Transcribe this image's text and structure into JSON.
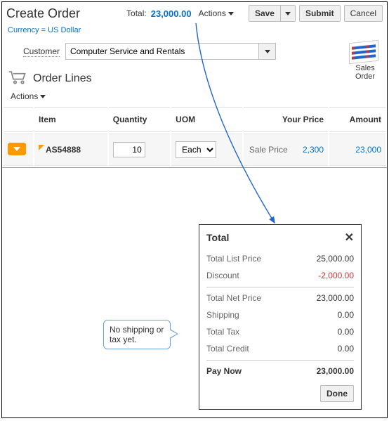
{
  "header": {
    "page_title": "Create Order",
    "total_label": "Total:",
    "total_value": "23,000.00",
    "actions_label": "Actions",
    "save_label": "Save",
    "submit_label": "Submit",
    "cancel_label": "Cancel",
    "currency_text": "Currency = US Dollar"
  },
  "customer": {
    "label": "Customer",
    "value": "Computer Service and Rentals"
  },
  "sales_order_tile": {
    "line1": "Sales",
    "line2": "Order"
  },
  "lines": {
    "title": "Order Lines",
    "actions_label": "Actions",
    "columns": {
      "item": "Item",
      "quantity": "Quantity",
      "uom": "UOM",
      "your_price": "Your Price",
      "amount": "Amount"
    },
    "rows": [
      {
        "item": "AS54888",
        "quantity": "10",
        "uom": "Each",
        "price_type": "Sale Price",
        "your_price": "2,300",
        "amount": "23,000"
      }
    ]
  },
  "totals": {
    "title": "Total",
    "rows": {
      "list_price_label": "Total List Price",
      "list_price_value": "25,000.00",
      "discount_label": "Discount",
      "discount_value": "-2,000.00",
      "net_label": "Total Net Price",
      "net_value": "23,000.00",
      "shipping_label": "Shipping",
      "shipping_value": "0.00",
      "tax_label": "Total Tax",
      "tax_value": "0.00",
      "credit_label": "Total Credit",
      "credit_value": "0.00",
      "paynow_label": "Pay Now",
      "paynow_value": "23,000.00"
    },
    "done_label": "Done"
  },
  "annotation": {
    "callout_text": "No shipping or tax yet."
  }
}
